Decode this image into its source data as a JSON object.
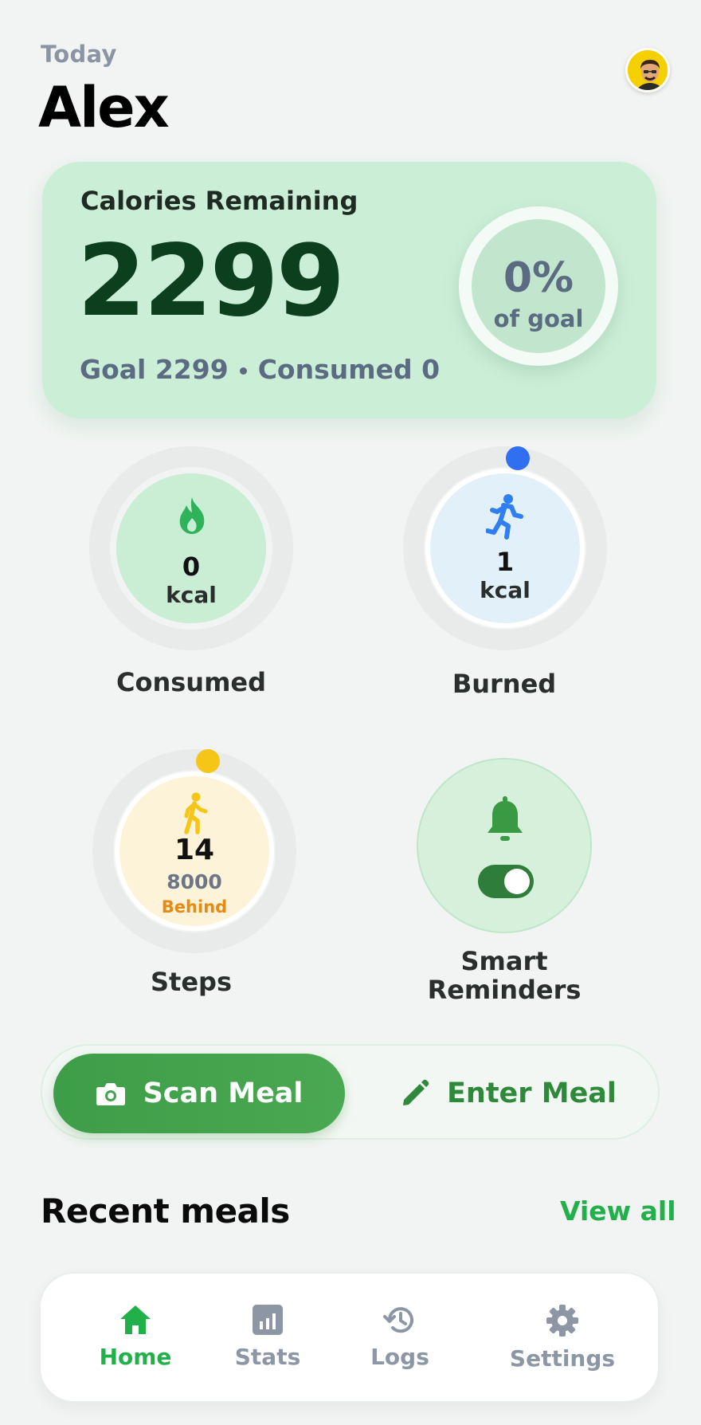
{
  "header": {
    "date_label": "Today",
    "user_name": "Alex"
  },
  "calories": {
    "title": "Calories Remaining",
    "remaining": "2299",
    "goal_text": "Goal 2299",
    "consumed_text": "Consumed 0",
    "goal_percent": "0%",
    "goal_percent_label": "of goal",
    "goal_progress": 0
  },
  "tiles": {
    "consumed": {
      "value": "0",
      "unit": "kcal",
      "label": "Consumed",
      "icon": "flame-icon",
      "color": "#2fb35a"
    },
    "burned": {
      "value": "1",
      "unit": "kcal",
      "label": "Burned",
      "icon": "running-icon",
      "color": "#2f7ff0"
    },
    "steps": {
      "value": "14",
      "goal": "8000",
      "status": "Behind",
      "label": "Steps",
      "icon": "walking-icon",
      "color": "#f5c518"
    },
    "reminders": {
      "label_line1": "Smart",
      "label_line2": "Reminders",
      "enabled": true,
      "icon": "bell-icon",
      "color": "#3a9a44"
    }
  },
  "actions": {
    "scan_label": "Scan Meal",
    "enter_label": "Enter Meal"
  },
  "recent": {
    "title": "Recent meals",
    "view_all": "View all"
  },
  "nav": {
    "home": "Home",
    "stats": "Stats",
    "logs": "Logs",
    "settings": "Settings",
    "active": "home",
    "active_color": "#22b04a",
    "inactive_color": "#8d96a5"
  }
}
